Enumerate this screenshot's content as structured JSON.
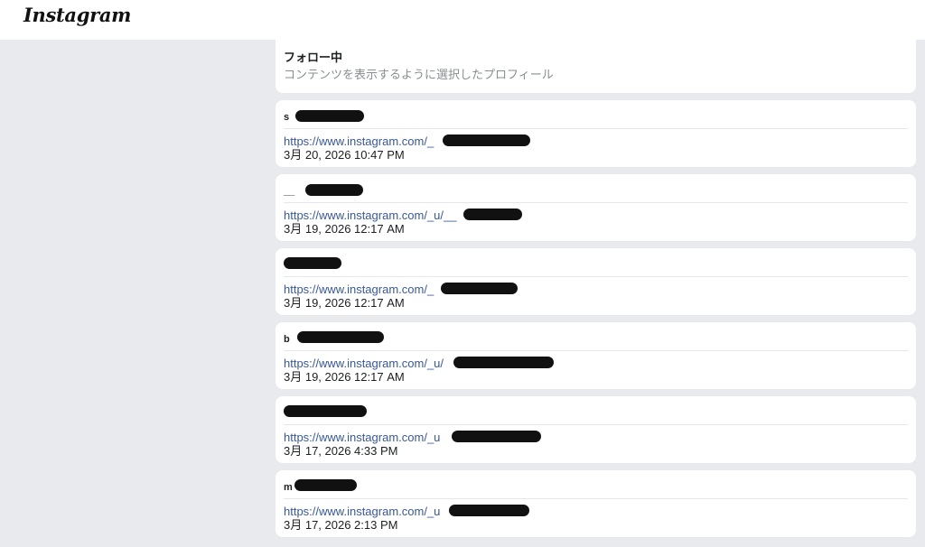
{
  "app": {
    "logo": "Instagram"
  },
  "section": {
    "title": "フォロー中",
    "subtitle": "コンテンツを表示するように選択したプロフィール"
  },
  "entries": [
    {
      "username": "s",
      "url": "https://www.instagram.com/_",
      "date": "3月 20, 2026 10:47 PM"
    },
    {
      "username": "__",
      "url": "https://www.instagram.com/_u/__",
      "date": "3月 19, 2026 12:17 AM"
    },
    {
      "username": "",
      "url": "https://www.instagram.com/_",
      "date": "3月 19, 2026 12:17 AM"
    },
    {
      "username": "b",
      "url": "https://www.instagram.com/_u/",
      "date": "3月 19, 2026 12:17 AM"
    },
    {
      "username": "",
      "url": "https://www.instagram.com/_u",
      "date": "3月 17, 2026 4:33 PM"
    },
    {
      "username": "m",
      "url": "https://www.instagram.com/_u",
      "date": "3月 17, 2026 2:13 PM"
    }
  ]
}
